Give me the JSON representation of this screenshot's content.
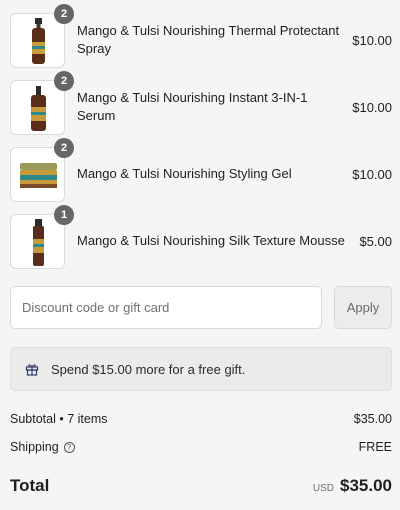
{
  "items": [
    {
      "qty": "2",
      "title": "Mango & Tulsi Nourishing Thermal Protectant Spray",
      "price": "$10.00",
      "product_icon": "spray-bottle-icon"
    },
    {
      "qty": "2",
      "title": "Mango & Tulsi Nourishing Instant 3-IN-1 Serum",
      "price": "$10.00",
      "product_icon": "serum-bottle-icon"
    },
    {
      "qty": "2",
      "title": "Mango & Tulsi Nourishing Styling Gel",
      "price": "$10.00",
      "product_icon": "gel-jar-icon"
    },
    {
      "qty": "1",
      "title": "Mango & Tulsi Nourishing Silk Texture Mousse",
      "price": "$5.00",
      "product_icon": "mousse-can-icon"
    }
  ],
  "discount": {
    "placeholder": "Discount code or gift card",
    "apply_label": "Apply"
  },
  "gift_banner": {
    "text": "Spend $15.00 more for a free gift.",
    "icon": "gift-icon"
  },
  "summary": {
    "subtotal_label": "Subtotal • 7 items",
    "subtotal_value": "$35.00",
    "shipping_label": "Shipping",
    "shipping_value": "FREE",
    "total_label": "Total",
    "currency": "USD",
    "total_value": "$35.00"
  },
  "colors": {
    "page_bg": "#f5f5f5",
    "badge_bg": "#666666",
    "product_gold": "#c79a3a",
    "product_teal": "#2e8a8a",
    "product_dark": "#5a2d1a"
  }
}
